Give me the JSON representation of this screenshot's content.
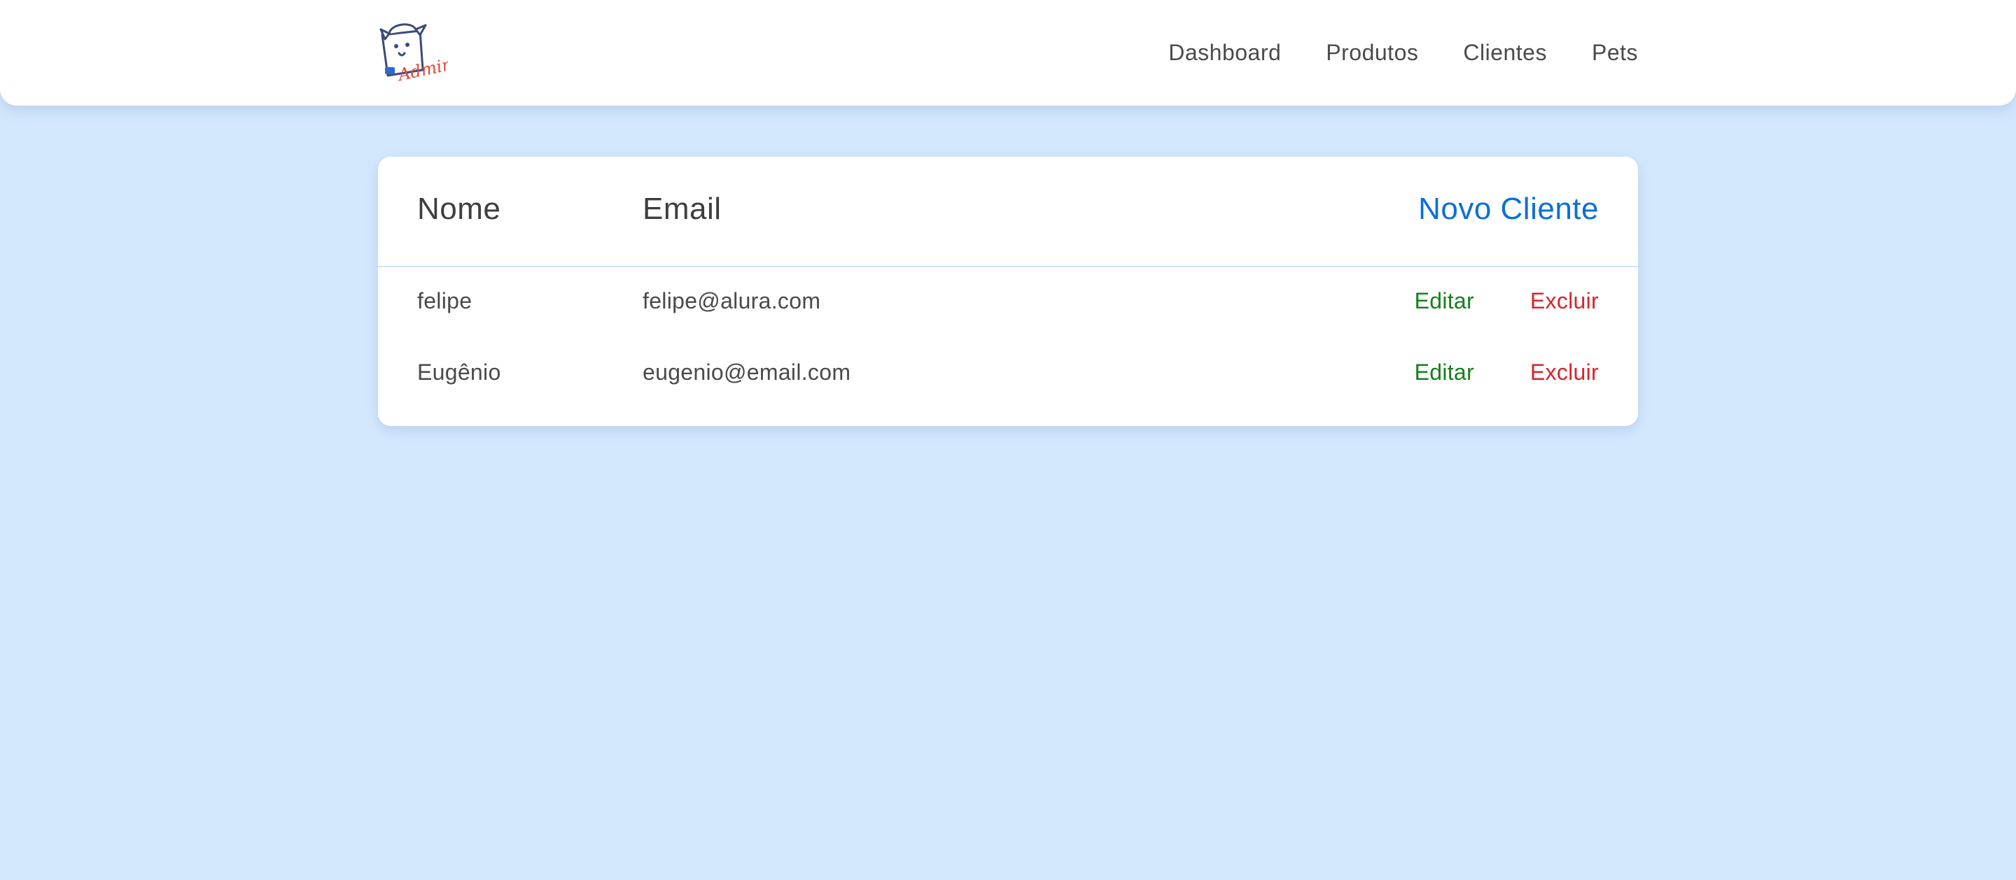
{
  "header": {
    "logo_text": "Admin",
    "nav": [
      {
        "label": "Dashboard"
      },
      {
        "label": "Produtos"
      },
      {
        "label": "Clientes"
      },
      {
        "label": "Pets"
      }
    ]
  },
  "table": {
    "columns": {
      "name": "Nome",
      "email": "Email"
    },
    "new_client_label": "Novo Cliente",
    "rows": [
      {
        "name": "felipe",
        "email": "felipe@alura.com",
        "edit_label": "Editar",
        "delete_label": "Excluir"
      },
      {
        "name": "Eugênio",
        "email": "eugenio@email.com",
        "edit_label": "Editar",
        "delete_label": "Excluir"
      }
    ]
  },
  "colors": {
    "background": "#d4e8fd",
    "link_blue": "#0b6fd8",
    "edit_green": "#15801c",
    "delete_red": "#d8242c"
  },
  "icons": {
    "logo": "dog-in-box-logo"
  }
}
